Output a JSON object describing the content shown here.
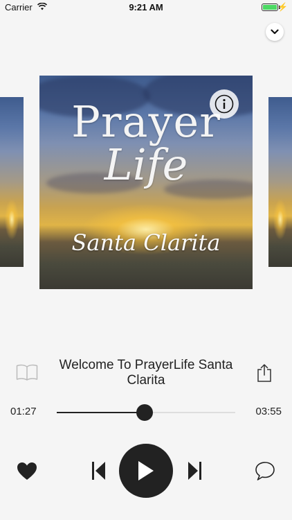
{
  "status_bar": {
    "carrier": "Carrier",
    "time": "9:21 AM"
  },
  "artwork": {
    "line1": "Prayer",
    "line2": "Life",
    "line3": "Santa Clarita",
    "info_icon": "info-circle-icon"
  },
  "track": {
    "title": "Welcome To PrayerLife Santa Clarita",
    "elapsed": "01:27",
    "duration": "03:55",
    "progress_fraction": 0.494
  },
  "icons": {
    "collapse": "chevron-down-icon",
    "book": "book-icon",
    "share": "share-icon",
    "favorite": "heart-icon",
    "previous": "skip-previous-icon",
    "play": "play-icon",
    "next": "skip-next-icon",
    "comment": "comment-icon"
  },
  "colors": {
    "accent": "#222222",
    "battery": "#4cd964",
    "background": "#f5f5f5"
  }
}
